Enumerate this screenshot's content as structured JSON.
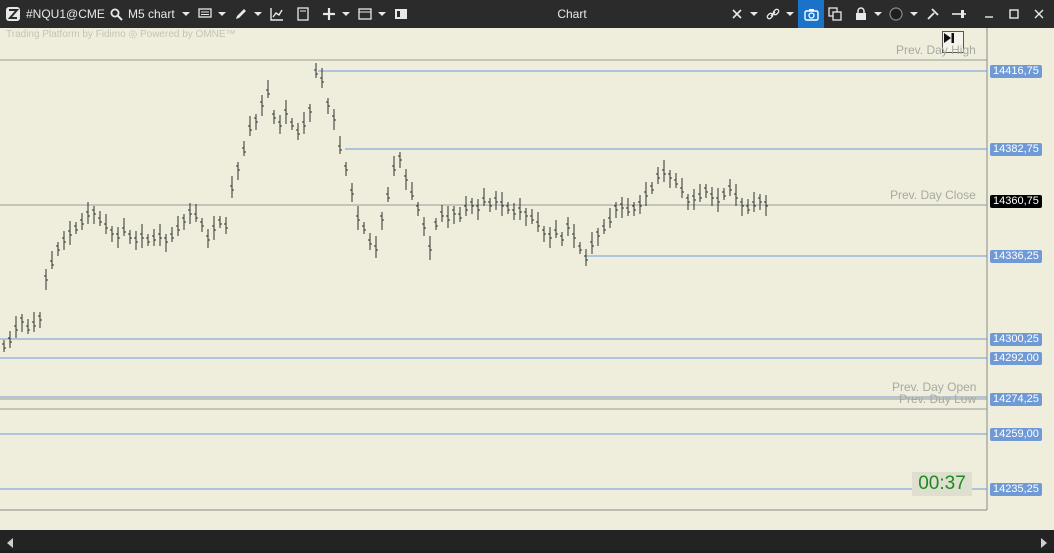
{
  "toolbar": {
    "symbol": "#NQU1@CME",
    "timeframe": "M5 chart",
    "window_title": "Chart"
  },
  "watermark": {
    "text1": "Trading Platform by Fidimo",
    "text2": "Powered by OMNE™"
  },
  "reference_labels": {
    "prev_day_high": "Prev. Day High",
    "prev_day_close": "Prev. Day Close",
    "prev_day_open": "Prev. Day Open",
    "prev_day_low": "Prev. Day Low"
  },
  "price_levels": [
    {
      "label": "14416,75",
      "kind": "blue"
    },
    {
      "label": "14382,75",
      "kind": "blue"
    },
    {
      "label": "14360,75",
      "kind": "current"
    },
    {
      "label": "14336,25",
      "kind": "blue"
    },
    {
      "label": "14300,25",
      "kind": "blue"
    },
    {
      "label": "14292,00",
      "kind": "blue"
    },
    {
      "label": "14274,25",
      "kind": "blue"
    },
    {
      "label": "14259,00",
      "kind": "blue"
    },
    {
      "label": "14235,25",
      "kind": "blue"
    }
  ],
  "bar_timer": "00:37",
  "colors": {
    "chart_bg": "#efeedc",
    "level_line": "#6f9ad6",
    "price_tag": "#6f9ad6",
    "current_tag": "#000000",
    "timer_text": "#1e8a1e",
    "accent_button": "#1a73c9"
  }
}
